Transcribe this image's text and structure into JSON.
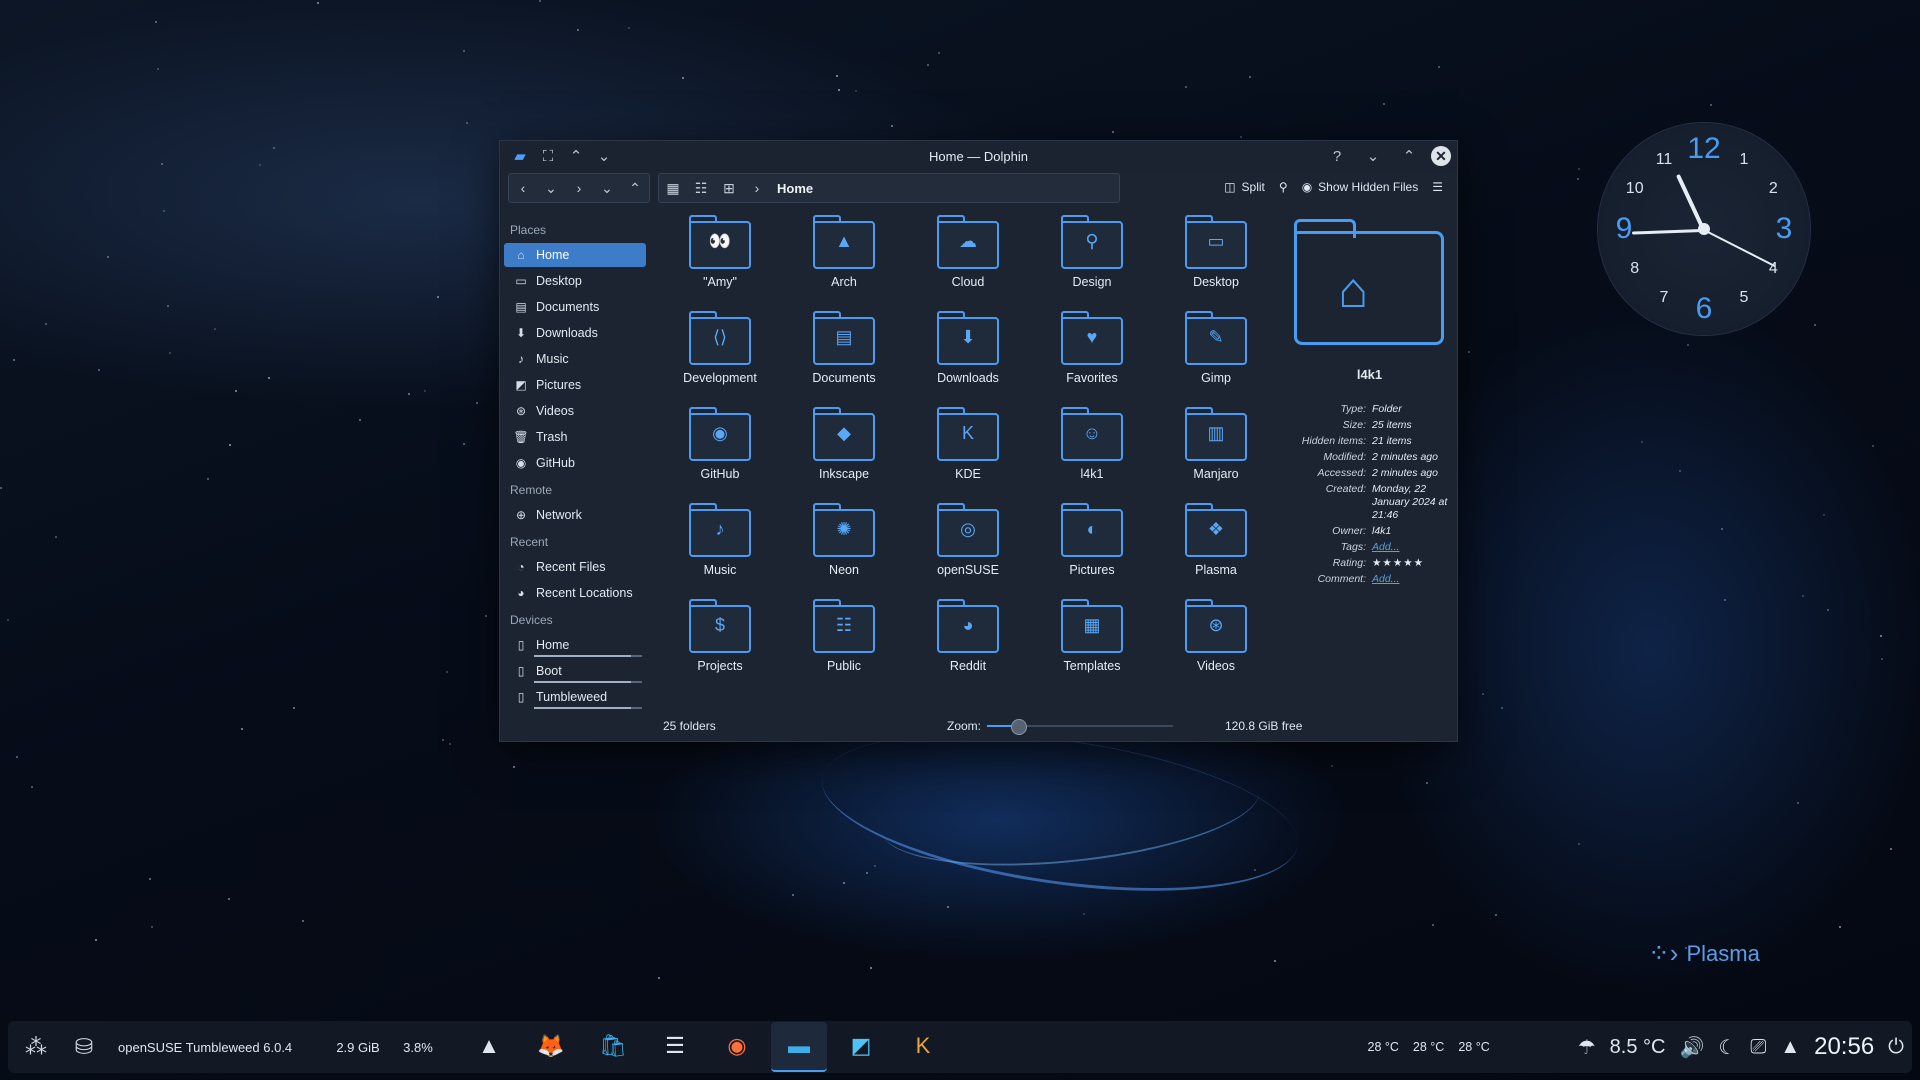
{
  "window": {
    "title": "Home — Dolphin"
  },
  "toolbar": {
    "breadcrumb": "Home",
    "split_label": "Split",
    "show_hidden_label": "Show Hidden Files"
  },
  "sidebar": {
    "places_title": "Places",
    "places": [
      {
        "label": "Home",
        "icon": "home-icon"
      },
      {
        "label": "Desktop",
        "icon": "desktop-icon"
      },
      {
        "label": "Documents",
        "icon": "documents-icon"
      },
      {
        "label": "Downloads",
        "icon": "downloads-icon"
      },
      {
        "label": "Music",
        "icon": "music-icon"
      },
      {
        "label": "Pictures",
        "icon": "pictures-icon"
      },
      {
        "label": "Videos",
        "icon": "videos-icon"
      },
      {
        "label": "Trash",
        "icon": "trash-icon"
      },
      {
        "label": "GitHub",
        "icon": "github-icon"
      }
    ],
    "remote_title": "Remote",
    "remote": [
      {
        "label": "Network",
        "icon": "network-icon"
      }
    ],
    "recent_title": "Recent",
    "recent": [
      {
        "label": "Recent Files",
        "icon": "recent-files-icon"
      },
      {
        "label": "Recent Locations",
        "icon": "recent-locations-icon"
      }
    ],
    "devices_title": "Devices",
    "devices": [
      {
        "label": "Home",
        "icon": "drive-icon",
        "usage": 0.9
      },
      {
        "label": "Boot",
        "icon": "drive-icon",
        "usage": 0.9
      },
      {
        "label": "Tumbleweed",
        "icon": "drive-icon",
        "usage": 0.9
      }
    ]
  },
  "files": [
    {
      "name": "\"Amy\"",
      "icon": "eyes-icon",
      "glyph": "👀"
    },
    {
      "name": "Arch",
      "icon": "arch-icon",
      "glyph": "▲"
    },
    {
      "name": "Cloud",
      "icon": "cloud-icon",
      "glyph": "☁"
    },
    {
      "name": "Design",
      "icon": "compass-icon",
      "glyph": "⚲"
    },
    {
      "name": "Desktop",
      "icon": "desktop-icon",
      "glyph": "▭"
    },
    {
      "name": "Development",
      "icon": "code-icon",
      "glyph": "⟨⟩"
    },
    {
      "name": "Documents",
      "icon": "document-icon",
      "glyph": "▤"
    },
    {
      "name": "Downloads",
      "icon": "download-icon",
      "glyph": "⬇"
    },
    {
      "name": "Favorites",
      "icon": "heart-icon",
      "glyph": "♥"
    },
    {
      "name": "Gimp",
      "icon": "gimp-icon",
      "glyph": "✎"
    },
    {
      "name": "GitHub",
      "icon": "github-icon",
      "glyph": "◉"
    },
    {
      "name": "Inkscape",
      "icon": "inkscape-icon",
      "glyph": "◆"
    },
    {
      "name": "KDE",
      "icon": "kde-icon",
      "glyph": "K"
    },
    {
      "name": "l4k1",
      "icon": "user-icon",
      "glyph": "☺"
    },
    {
      "name": "Manjaro",
      "icon": "manjaro-icon",
      "glyph": "▥"
    },
    {
      "name": "Music",
      "icon": "music-icon",
      "glyph": "♪"
    },
    {
      "name": "Neon",
      "icon": "neon-icon",
      "glyph": "✺"
    },
    {
      "name": "openSUSE",
      "icon": "opensuse-icon",
      "glyph": "◎"
    },
    {
      "name": "Pictures",
      "icon": "pictures-icon",
      "glyph": "◐"
    },
    {
      "name": "Plasma",
      "icon": "plasma-icon",
      "glyph": "❖"
    },
    {
      "name": "Projects",
      "icon": "dollar-icon",
      "glyph": "$"
    },
    {
      "name": "Public",
      "icon": "people-icon",
      "glyph": "☷"
    },
    {
      "name": "Reddit",
      "icon": "reddit-icon",
      "glyph": "◕"
    },
    {
      "name": "Templates",
      "icon": "template-icon",
      "glyph": "▦"
    },
    {
      "name": "Videos",
      "icon": "film-icon",
      "glyph": "⊛"
    }
  ],
  "info": {
    "name": "l4k1",
    "props": [
      {
        "k": "Type:",
        "v": "Folder"
      },
      {
        "k": "Size:",
        "v": "25 items"
      },
      {
        "k": "Hidden items:",
        "v": "21 items"
      },
      {
        "k": "Modified:",
        "v": "2 minutes ago"
      },
      {
        "k": "Accessed:",
        "v": "2 minutes ago"
      },
      {
        "k": "Created:",
        "v": "Monday, 22 January 2024 at 21:46"
      },
      {
        "k": "Owner:",
        "v": "l4k1"
      },
      {
        "k": "Tags:",
        "v": "Add...",
        "link": true
      },
      {
        "k": "Rating:",
        "v": "★★★★★",
        "stars": true
      },
      {
        "k": "Comment:",
        "v": "Add...",
        "link": true
      }
    ]
  },
  "status": {
    "count": "25 folders",
    "zoom_label": "Zoom:",
    "zoom_level": 0.15,
    "free": "120.8 GiB free"
  },
  "clock": {
    "numbers": [
      "12",
      "1",
      "2",
      "3",
      "4",
      "5",
      "6",
      "7",
      "8",
      "9",
      "10",
      "11"
    ]
  },
  "plasma_logo": "Plasma",
  "taskbar": {
    "os_label": "openSUSE Tumbleweed 6.0.4",
    "memory": "2.9 GiB",
    "cpu": "3.8%",
    "apps": [
      {
        "name": "inkscape-app-icon",
        "glyph": "▲",
        "color": "#dfe6ee"
      },
      {
        "name": "gimp-app-icon",
        "glyph": "🦊",
        "color": "#d7b27a"
      },
      {
        "name": "discover-app-icon",
        "glyph": "🛍",
        "color": "#3daee9"
      },
      {
        "name": "settings-app-icon",
        "glyph": "☰",
        "color": "#dfe6ee"
      },
      {
        "name": "firefox-app-icon",
        "glyph": "◉",
        "color": "#ff7139"
      },
      {
        "name": "dolphin-app-icon",
        "glyph": "▬",
        "color": "#3daee9",
        "active": true
      },
      {
        "name": "spectacle-app-icon",
        "glyph": "◩",
        "color": "#4fc3f7"
      },
      {
        "name": "krita-app-icon",
        "glyph": "K",
        "color": "#e8a33d"
      }
    ],
    "temps": [
      "28 °C",
      "28 °C",
      "28 °C"
    ],
    "weather_temp": "8.5 °C",
    "time": "20:56"
  }
}
